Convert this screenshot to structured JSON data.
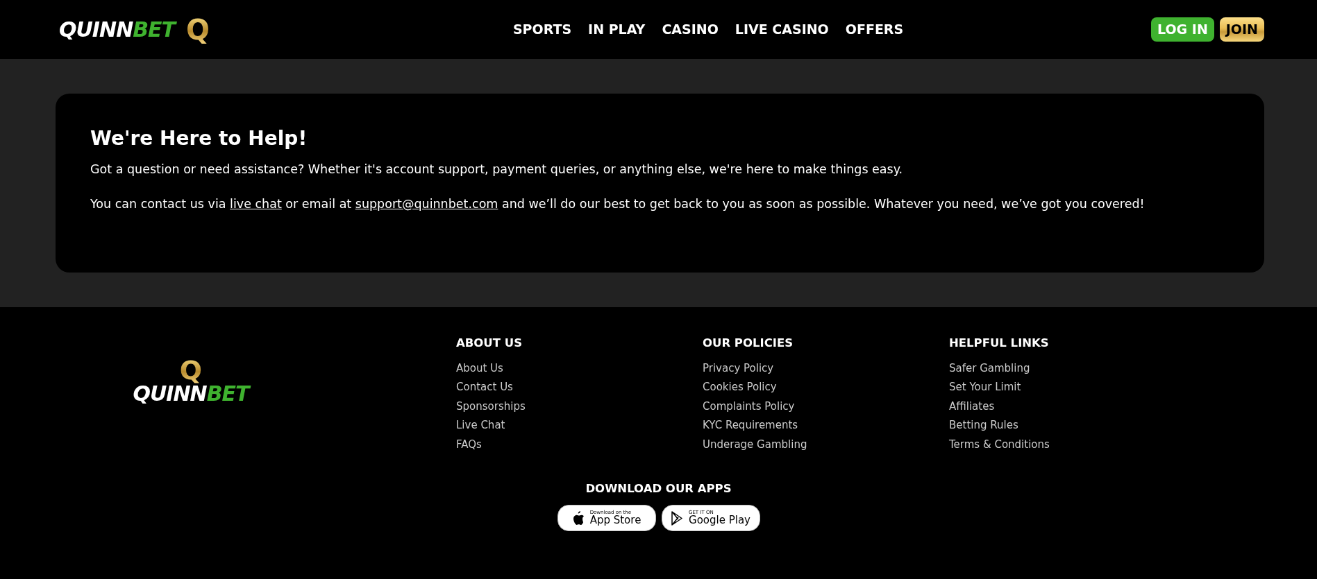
{
  "header": {
    "logo": {
      "word_1": "QUINN",
      "word_2": "BET",
      "mark": "Q"
    },
    "nav": [
      {
        "label": "SPORTS"
      },
      {
        "label": "IN PLAY"
      },
      {
        "label": "CASINO"
      },
      {
        "label": "LIVE CASINO"
      },
      {
        "label": "OFFERS"
      }
    ],
    "buttons": [
      {
        "label": "LOG IN",
        "kind": "login"
      },
      {
        "label": "JOIN",
        "kind": "join"
      }
    ]
  },
  "help_card": {
    "title": "We're Here to Help!",
    "paragraphs": [
      [
        {
          "kind": "text",
          "text": "Got a question or need assistance? Whether it's account support, payment queries, or anything else, we're here to make things easy."
        }
      ],
      [
        {
          "kind": "text",
          "text": "You can contact us via "
        },
        {
          "kind": "link",
          "text": "live chat"
        },
        {
          "kind": "text",
          "text": " or email at "
        },
        {
          "kind": "link",
          "text": "support@quinnbet.com"
        },
        {
          "kind": "text",
          "text": " and we’ll do our best to get back to you as soon as possible. Whatever you need, we’ve got you covered!"
        }
      ]
    ]
  },
  "footer": {
    "logo": {
      "mark": "Q",
      "word_1": "QUINN",
      "word_2": "BET"
    },
    "columns": [
      {
        "heading": "ABOUT US",
        "links": [
          "About Us",
          "Contact Us",
          "Sponsorships",
          "Live Chat",
          "FAQs"
        ]
      },
      {
        "heading": "OUR POLICIES",
        "links": [
          "Privacy Policy",
          "Cookies Policy",
          "Complaints Policy",
          "KYC Requirements",
          "Underage Gambling"
        ]
      },
      {
        "heading": "HELPFUL LINKS",
        "links": [
          "Safer Gambling",
          "Set Your Limit",
          "Affiliates",
          "Betting Rules",
          "Terms & Conditions"
        ]
      }
    ],
    "apps": {
      "heading": "DOWNLOAD OUR APPS",
      "badges": [
        {
          "kind": "apple",
          "small": "Download on the",
          "big": "App Store"
        },
        {
          "kind": "google",
          "small": "GET IT ON",
          "big": "Google Play"
        }
      ]
    }
  }
}
